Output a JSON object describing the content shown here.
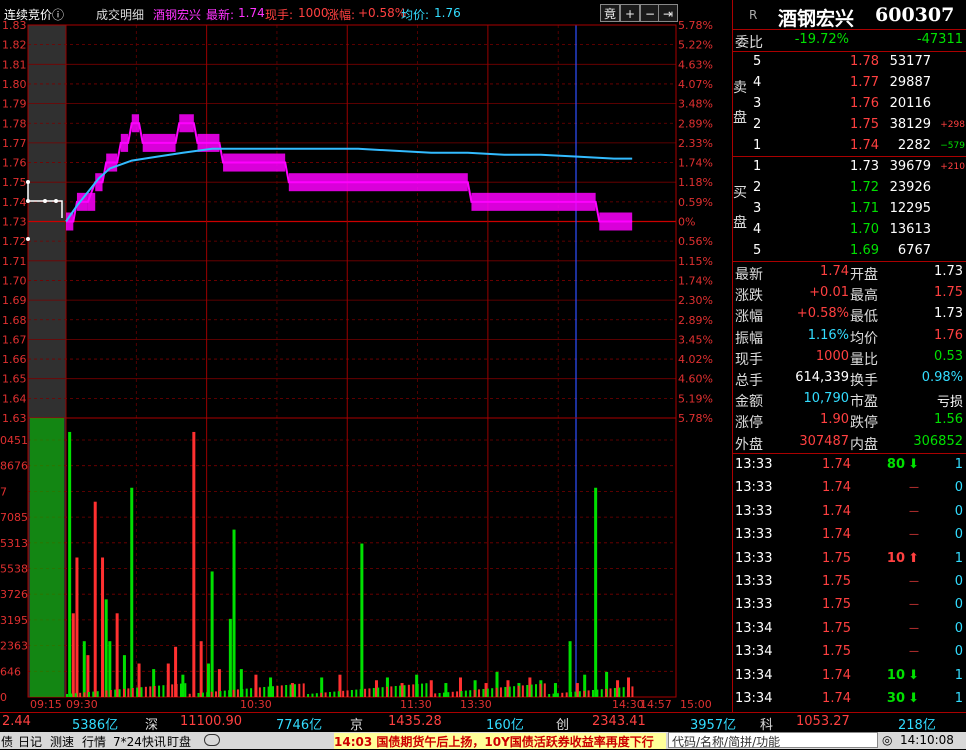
{
  "stock": {
    "code_label": "R",
    "name": "酒钢宏兴",
    "code": "600307"
  },
  "toolbar": {
    "auction_label": "连续竞价ⓘ",
    "trade_detail_label": "成交明细",
    "stock_name": "酒钢宏兴",
    "latest_label": "最新:",
    "latest_value": "1.74",
    "current_label": "现手:",
    "current_value": "1000",
    "change_label": "涨幅:",
    "change_value": "+0.58%",
    "avg_label": "均价:",
    "avg_value": "1.76",
    "btn_compete": "竟",
    "btn_plus": "+",
    "btn_minus": "−",
    "btn_next": "⇥"
  },
  "chart_data": {
    "type": "line",
    "price_axis_left": [
      "1.83",
      "1.82",
      "1.81",
      "1.80",
      "1.79",
      "1.78",
      "1.77",
      "1.76",
      "1.75",
      "1.74",
      "1.73",
      "1.72",
      "1.71",
      "1.70",
      "1.69",
      "1.68",
      "1.67",
      "1.66",
      "1.65",
      "1.64",
      "1.63"
    ],
    "pct_axis_right": [
      "5.78%",
      "5.22%",
      "4.63%",
      "4.07%",
      "3.48%",
      "2.89%",
      "2.33%",
      "1.74%",
      "1.18%",
      "0.59%",
      "0%",
      "0.56%",
      "1.15%",
      "1.74%",
      "2.30%",
      "2.89%",
      "3.45%",
      "4.02%",
      "4.60%",
      "5.19%",
      "5.78%"
    ],
    "volume_axis_left": [
      "0451",
      "8676",
      "7",
      "7085",
      "5313",
      "5538",
      "3726",
      "3195",
      "2363",
      "646",
      "0"
    ],
    "time_labels": [
      "09:15",
      "09:30",
      "10:30",
      "11:30",
      "13:30",
      "14:30",
      "14:57",
      "15:00"
    ],
    "ylim": [
      1.63,
      1.83
    ],
    "prev_close": 1.73,
    "price_series": [
      [
        0,
        1.73
      ],
      [
        2,
        1.73
      ],
      [
        3,
        1.74
      ],
      [
        6,
        1.74
      ],
      [
        8,
        1.75
      ],
      [
        10,
        1.75
      ],
      [
        11,
        1.76
      ],
      [
        14,
        1.76
      ],
      [
        15,
        1.77
      ],
      [
        17,
        1.77
      ],
      [
        18,
        1.78
      ],
      [
        20,
        1.78
      ],
      [
        21,
        1.77
      ],
      [
        30,
        1.77
      ],
      [
        31,
        1.78
      ],
      [
        35,
        1.78
      ],
      [
        36,
        1.77
      ],
      [
        42,
        1.77
      ],
      [
        43,
        1.76
      ],
      [
        60,
        1.76
      ],
      [
        61,
        1.75
      ],
      [
        110,
        1.75
      ],
      [
        111,
        1.74
      ],
      [
        145,
        1.74
      ],
      [
        146,
        1.73
      ],
      [
        155,
        1.73
      ]
    ],
    "avg_series": [
      [
        0,
        1.73
      ],
      [
        3,
        1.738
      ],
      [
        6,
        1.745
      ],
      [
        9,
        1.752
      ],
      [
        12,
        1.757
      ],
      [
        18,
        1.761
      ],
      [
        25,
        1.763
      ],
      [
        32,
        1.765
      ],
      [
        40,
        1.767
      ],
      [
        50,
        1.767
      ],
      [
        60,
        1.767
      ],
      [
        70,
        1.767
      ],
      [
        80,
        1.767
      ],
      [
        90,
        1.766
      ],
      [
        100,
        1.765
      ],
      [
        110,
        1.765
      ],
      [
        120,
        1.764
      ],
      [
        130,
        1.764
      ],
      [
        140,
        1.763
      ],
      [
        150,
        1.762
      ],
      [
        155,
        1.762
      ]
    ],
    "volume_bars": [
      [
        1,
        0.95,
        "g"
      ],
      [
        2,
        0.3,
        "r"
      ],
      [
        3,
        0.5,
        "r"
      ],
      [
        5,
        0.2,
        "g"
      ],
      [
        6,
        0.15,
        "r"
      ],
      [
        8,
        0.7,
        "r"
      ],
      [
        10,
        0.5,
        "r"
      ],
      [
        11,
        0.35,
        "g"
      ],
      [
        12,
        0.2,
        "g"
      ],
      [
        14,
        0.3,
        "r"
      ],
      [
        16,
        0.15,
        "g"
      ],
      [
        18,
        0.75,
        "g"
      ],
      [
        20,
        0.12,
        "r"
      ],
      [
        24,
        0.1,
        "g"
      ],
      [
        28,
        0.12,
        "r"
      ],
      [
        30,
        0.18,
        "r"
      ],
      [
        32,
        0.08,
        "g"
      ],
      [
        35,
        0.95,
        "r"
      ],
      [
        37,
        0.2,
        "r"
      ],
      [
        39,
        0.12,
        "g"
      ],
      [
        40,
        0.45,
        "g"
      ],
      [
        42,
        0.1,
        "r"
      ],
      [
        45,
        0.28,
        "g"
      ],
      [
        46,
        0.6,
        "g"
      ],
      [
        48,
        0.1,
        "g"
      ],
      [
        52,
        0.08,
        "r"
      ],
      [
        56,
        0.07,
        "g"
      ],
      [
        62,
        0.05,
        "r"
      ],
      [
        70,
        0.07,
        "g"
      ],
      [
        75,
        0.08,
        "r"
      ],
      [
        81,
        0.55,
        "g"
      ],
      [
        85,
        0.06,
        "r"
      ],
      [
        88,
        0.07,
        "g"
      ],
      [
        92,
        0.05,
        "r"
      ],
      [
        96,
        0.08,
        "g"
      ],
      [
        100,
        0.06,
        "r"
      ],
      [
        104,
        0.05,
        "g"
      ],
      [
        108,
        0.07,
        "r"
      ],
      [
        112,
        0.06,
        "g"
      ],
      [
        115,
        0.05,
        "r"
      ],
      [
        118,
        0.09,
        "g"
      ],
      [
        121,
        0.06,
        "r"
      ],
      [
        124,
        0.05,
        "g"
      ],
      [
        127,
        0.07,
        "r"
      ],
      [
        130,
        0.06,
        "g"
      ],
      [
        134,
        0.05,
        "g"
      ],
      [
        138,
        0.2,
        "g"
      ],
      [
        140,
        0.05,
        "r"
      ],
      [
        142,
        0.08,
        "g"
      ],
      [
        145,
        0.75,
        "g"
      ],
      [
        148,
        0.09,
        "g"
      ],
      [
        151,
        0.06,
        "r"
      ],
      [
        154,
        0.07,
        "r"
      ]
    ],
    "time_positions": [
      0,
      0,
      38.5,
      77,
      115.5,
      154,
      155.5,
      167
    ]
  },
  "quote": {
    "ratio_label": "委比",
    "ratio_pct": "-19.72%",
    "ratio_diff": "-47311",
    "sell_label": "卖盘",
    "buy_label": "买盘",
    "asks": [
      {
        "level": "5",
        "price": "1.78",
        "vol": "53177",
        "chg": ""
      },
      {
        "level": "4",
        "price": "1.77",
        "vol": "29887",
        "chg": ""
      },
      {
        "level": "3",
        "price": "1.76",
        "vol": "20116",
        "chg": ""
      },
      {
        "level": "2",
        "price": "1.75",
        "vol": "38129",
        "chg": "+298"
      },
      {
        "level": "1",
        "price": "1.74",
        "vol": "2282",
        "chg": "−579"
      }
    ],
    "bids": [
      {
        "level": "1",
        "price": "1.73",
        "vol": "39679",
        "chg": "+210"
      },
      {
        "level": "2",
        "price": "1.72",
        "vol": "23926",
        "chg": ""
      },
      {
        "level": "3",
        "price": "1.71",
        "vol": "12295",
        "chg": ""
      },
      {
        "level": "4",
        "price": "1.70",
        "vol": "13613",
        "chg": ""
      },
      {
        "level": "5",
        "price": "1.69",
        "vol": "6767",
        "chg": ""
      }
    ],
    "stats": [
      {
        "l1": "最新",
        "v1": "1.74",
        "c1": "red",
        "l2": "开盘",
        "v2": "1.73",
        "c2": "wht"
      },
      {
        "l1": "涨跌",
        "v1": "+0.01",
        "c1": "red",
        "l2": "最高",
        "v2": "1.75",
        "c2": "red"
      },
      {
        "l1": "涨幅",
        "v1": "+0.58%",
        "c1": "red",
        "l2": "最低",
        "v2": "1.73",
        "c2": "wht"
      },
      {
        "l1": "振幅",
        "v1": "1.16%",
        "c1": "cyan",
        "l2": "均价",
        "v2": "1.76",
        "c2": "red"
      },
      {
        "l1": "现手",
        "v1": "1000",
        "c1": "red",
        "l2": "量比",
        "v2": "0.53",
        "c2": "grn"
      },
      {
        "l1": "总手",
        "v1": "614,339",
        "c1": "wht",
        "l2": "换手",
        "v2": "0.98%",
        "c2": "cyan"
      },
      {
        "l1": "金额",
        "v1": "10,790",
        "c1": "cyan",
        "l2": "市盈",
        "v2": "亏损",
        "c2": "wht"
      },
      {
        "l1": "涨停",
        "v1": "1.90",
        "c1": "red",
        "l2": "跌停",
        "v2": "1.56",
        "c2": "grn"
      },
      {
        "l1": "外盘",
        "v1": "307487",
        "c1": "red",
        "l2": "内盘",
        "v2": "306852",
        "c2": "grn"
      }
    ]
  },
  "ticks": [
    {
      "time": "13:33",
      "price": "1.74",
      "vol": "80",
      "dir": "down",
      "num": "1"
    },
    {
      "time": "13:33",
      "price": "1.74",
      "vol": "",
      "dir": "dash",
      "num": "0"
    },
    {
      "time": "13:33",
      "price": "1.74",
      "vol": "",
      "dir": "dash",
      "num": "0"
    },
    {
      "time": "13:33",
      "price": "1.74",
      "vol": "",
      "dir": "dash",
      "num": "0"
    },
    {
      "time": "13:33",
      "price": "1.75",
      "vol": "10",
      "dir": "up",
      "num": "1"
    },
    {
      "time": "13:33",
      "price": "1.75",
      "vol": "",
      "dir": "dash",
      "num": "0"
    },
    {
      "time": "13:33",
      "price": "1.75",
      "vol": "",
      "dir": "dash",
      "num": "0"
    },
    {
      "time": "13:34",
      "price": "1.75",
      "vol": "",
      "dir": "dash",
      "num": "0"
    },
    {
      "time": "13:34",
      "price": "1.75",
      "vol": "",
      "dir": "dash",
      "num": "0"
    },
    {
      "time": "13:34",
      "price": "1.74",
      "vol": "10",
      "dir": "down",
      "num": "1"
    },
    {
      "time": "13:34",
      "price": "1.74",
      "vol": "30",
      "dir": "down",
      "num": "1"
    }
  ],
  "index_bar": [
    {
      "name": "",
      "value": "2.44",
      "amount": "5386亿"
    },
    {
      "name": "深",
      "value": "11100.90",
      "amount": "7746亿"
    },
    {
      "name": "京",
      "value": "1435.28",
      "amount": "160亿"
    },
    {
      "name": "创",
      "value": "2343.41",
      "amount": "3957亿"
    },
    {
      "name": "科",
      "value": "1053.27",
      "amount": "218亿"
    }
  ],
  "statusbar": {
    "tabs": [
      "债",
      "日记",
      "测速",
      "行情",
      "7*24快讯",
      "盯盘"
    ],
    "news": "14:03 国债期货午后上扬，10Y国债活跃券收益率再度下行",
    "search_placeholder": "代码/名称/简拼/功能",
    "clock": "14:10:08"
  }
}
